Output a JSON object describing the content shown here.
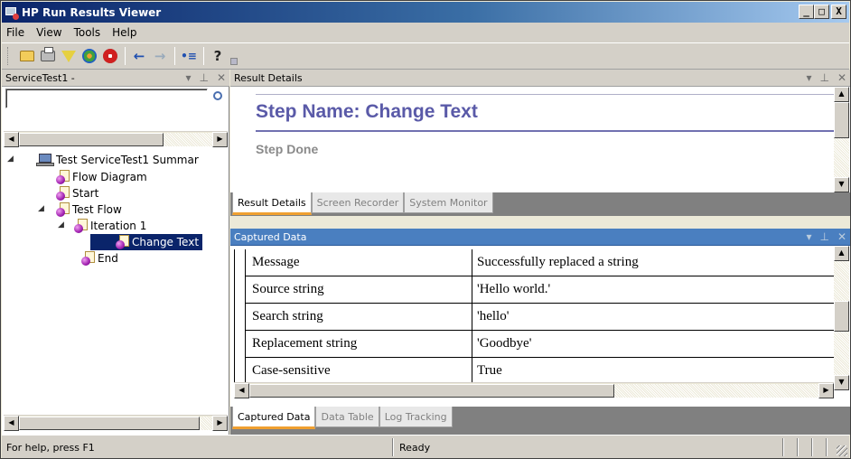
{
  "window": {
    "title": "HP Run Results Viewer",
    "minimize": "_",
    "maximize": "□",
    "close": "X"
  },
  "menu": [
    "File",
    "View",
    "Tools",
    "Help"
  ],
  "toolbar": {
    "back": "←",
    "forward": "→",
    "indent": "•≡",
    "help": "?"
  },
  "left_panel": {
    "title": "ServiceTest1 -",
    "search": {
      "value": "",
      "placeholder": ""
    },
    "tree": [
      {
        "label": "Test ServiceTest1 Summar",
        "expander": "◢"
      },
      {
        "label": "Flow Diagram"
      },
      {
        "label": "Start"
      },
      {
        "label": "Test Flow",
        "expander": "◢"
      },
      {
        "label": "Iteration 1",
        "expander": "◢"
      },
      {
        "label": "Change Text",
        "selected": true
      },
      {
        "label": "End"
      }
    ]
  },
  "panel_controls": {
    "dropdown": "▾",
    "pin": "⊥",
    "close": "✕"
  },
  "result_details": {
    "title": "Result Details",
    "step_name": "Step Name: Change Text",
    "step_status": "Step Done",
    "tabs": [
      "Result Details",
      "Screen Recorder",
      "System Monitor"
    ]
  },
  "captured_data": {
    "title": "Captured Data",
    "rows": [
      {
        "name": "Message",
        "value": "Successfully replaced a  string"
      },
      {
        "name": "Source string",
        "value": "'Hello world.'"
      },
      {
        "name": "Search string",
        "value": "'hello'"
      },
      {
        "name": "Replacement string",
        "value": "'Goodbye'"
      },
      {
        "name": "Case-sensitive",
        "value": "True"
      }
    ],
    "tabs": [
      "Captured Data",
      "Data Table",
      "Log Tracking"
    ]
  },
  "scroll": {
    "up": "▲",
    "down": "▼",
    "left": "◀",
    "right": "▶"
  },
  "status": {
    "help": "For help, press F1",
    "state": "Ready"
  }
}
